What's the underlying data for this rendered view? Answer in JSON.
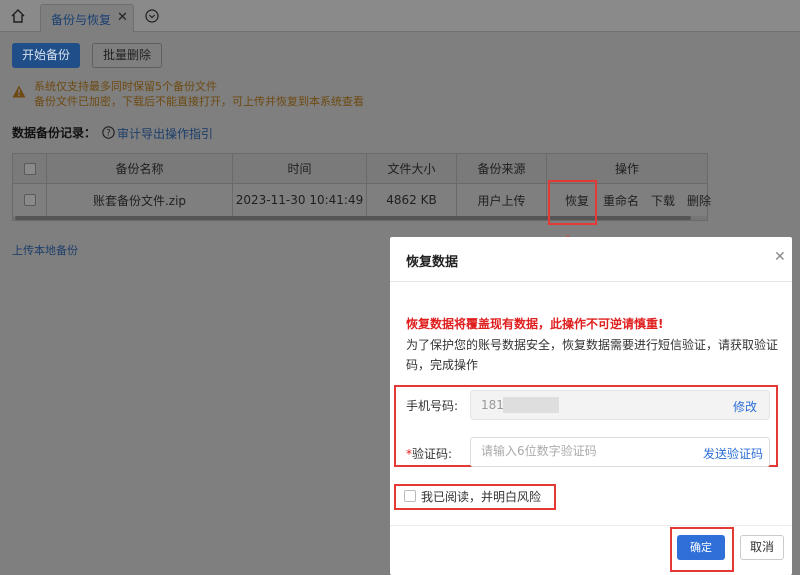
{
  "tabs": {
    "home_icon": "home-icon",
    "active_label": "备份与恢复",
    "close_glyph": "✕",
    "more_icon": "chevron-down-circle-icon"
  },
  "toolbar": {
    "start_backup": "开始备份",
    "batch_delete": "批量删除"
  },
  "notice": {
    "line1": "系统仅支持最多同时保留5个备份文件",
    "line2": "备份文件已加密，下载后不能直接打开，可上传并恢复到本系统查看"
  },
  "records": {
    "label": "数据备份记录：",
    "guide_link": "审计导出操作指引"
  },
  "table": {
    "headers": {
      "name": "备份名称",
      "time": "时间",
      "size": "文件大小",
      "source": "备份来源",
      "actions": "操作"
    },
    "rows": [
      {
        "name": "账套备份文件.zip",
        "time": "2023-11-30 10:41:49",
        "size": "4862 KB",
        "source": "用户上传",
        "actions": {
          "restore": "恢复",
          "rename": "重命名",
          "download": "下载",
          "delete": "删除"
        }
      }
    ]
  },
  "upload_link": "上传本地备份",
  "dialog": {
    "title": "恢复数据",
    "close_glyph": "✕",
    "warning": "恢复数据将覆盖现有数据，此操作不可逆请慎重!",
    "description": "为了保护您的账号数据安全，恢复数据需要进行短信验证，请获取验证码，完成操作",
    "phone_label": "手机号码:",
    "phone_value": "181",
    "phone_edit": "修改",
    "code_required_mark": "*",
    "code_label": "验证码:",
    "code_placeholder": "请输入6位数字验证码",
    "send_code": "发送验证码",
    "agree_label": "我已阅读，并明白风险",
    "confirm": "确定",
    "cancel": "取消"
  },
  "colors": {
    "primary": "#2e6fd8",
    "danger": "#e02020",
    "highlight": "#e53935",
    "overlay": "#7f7f7f"
  }
}
